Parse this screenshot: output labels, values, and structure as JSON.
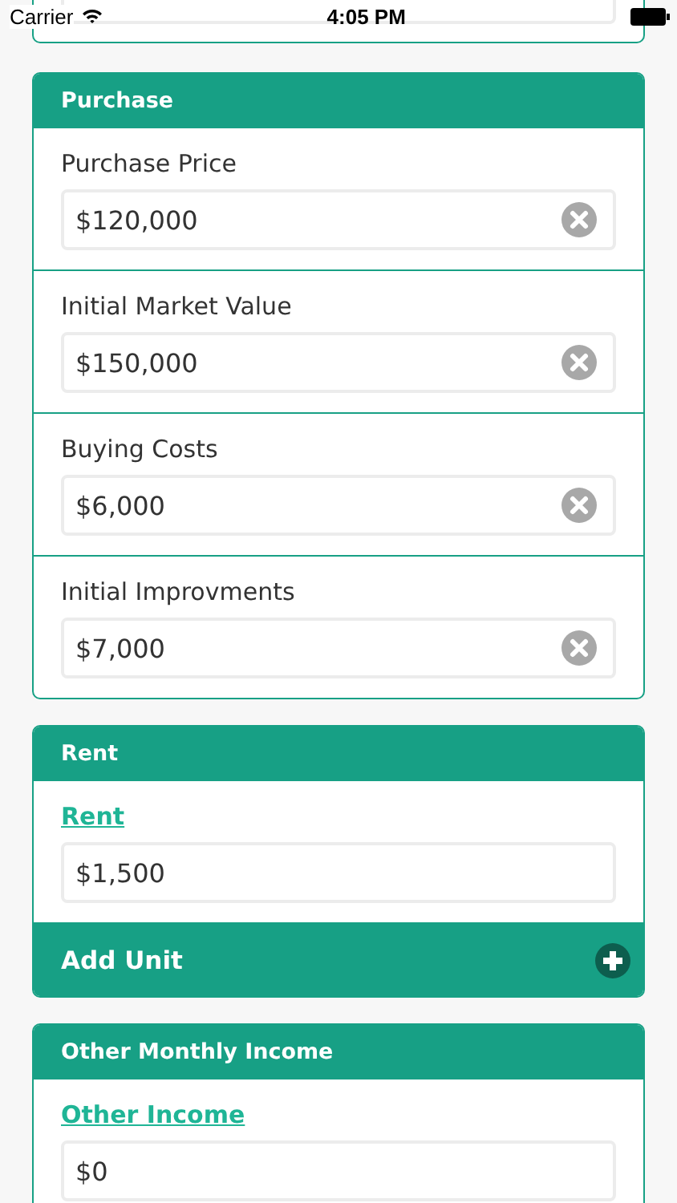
{
  "status_bar": {
    "carrier": "Carrier",
    "time": "4:05 PM"
  },
  "sections": [
    {
      "title": "Purchase",
      "fields": [
        {
          "label": "Purchase Price",
          "kind": "plain",
          "value": "$120,000",
          "clearable": true
        },
        {
          "label": "Initial Market Value",
          "kind": "plain",
          "value": "$150,000",
          "clearable": true
        },
        {
          "label": "Buying Costs",
          "kind": "plain",
          "value": "$6,000",
          "clearable": true
        },
        {
          "label": "Initial Improvments",
          "kind": "plain",
          "value": "$7,000",
          "clearable": true
        }
      ]
    },
    {
      "title": "Rent",
      "fields": [
        {
          "label": "Rent",
          "kind": "link",
          "value": "$1,500",
          "clearable": false
        }
      ],
      "action": "Add Unit"
    },
    {
      "title": "Other Monthly Income",
      "fields": [
        {
          "label": "Other Income",
          "kind": "link",
          "value": "$0",
          "clearable": false
        }
      ]
    }
  ]
}
